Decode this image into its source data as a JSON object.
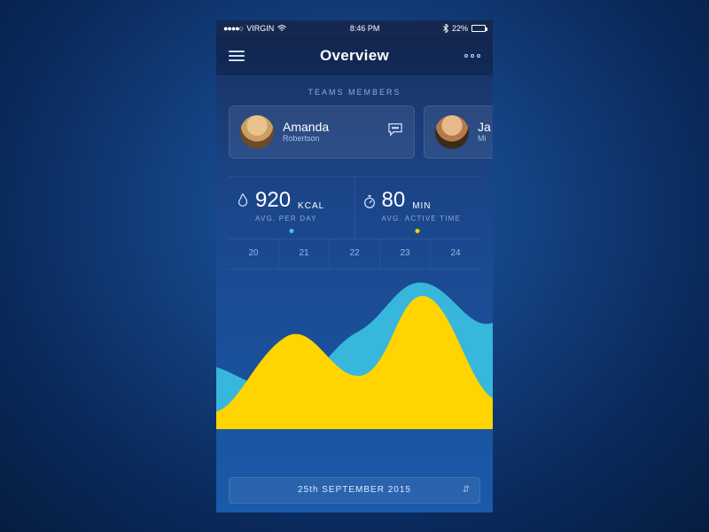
{
  "status_bar": {
    "carrier": "VIRGIN",
    "time": "8:46 PM",
    "battery_pct": "22%"
  },
  "nav": {
    "title": "Overview"
  },
  "teams_label": "TEAMS MEMBERS",
  "members": [
    {
      "first": "Amanda",
      "last": "Robertson"
    },
    {
      "first": "Ja",
      "last": "Mi"
    }
  ],
  "stats": {
    "kcal": {
      "value": "920",
      "unit": "KCAL",
      "sub": "AVG. PER DAY"
    },
    "active": {
      "value": "80",
      "unit": "MIN",
      "sub": "AVG. ACTIVE TIME"
    }
  },
  "axis_days": [
    "20",
    "21",
    "22",
    "23",
    "24"
  ],
  "date_picker": "25th SEPTEMBER 2015",
  "colors": {
    "series_back": "#37b7db",
    "series_front": "#ffd400"
  },
  "chart_data": {
    "type": "area",
    "categories": [
      "20",
      "21",
      "22",
      "23",
      "24"
    ],
    "series": [
      {
        "name": "avg-active-time-min",
        "color": "#37b7db",
        "values": [
          55,
          30,
          60,
          120,
          80
        ]
      },
      {
        "name": "avg-kcal-per-day",
        "color": "#ffd400",
        "values": [
          15,
          85,
          40,
          110,
          30
        ]
      }
    ],
    "ylim": [
      0,
      140
    ],
    "xlabel": "",
    "ylabel": "",
    "title": ""
  }
}
